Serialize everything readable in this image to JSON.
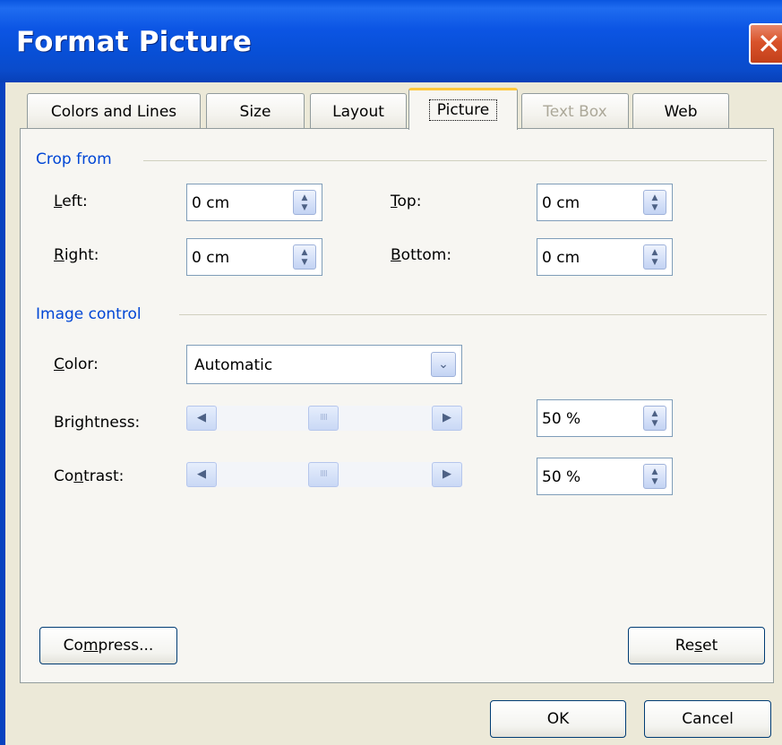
{
  "window": {
    "title": "Format Picture",
    "close_glyph": "✕"
  },
  "tabs": [
    {
      "label": "Colors and Lines",
      "state": "normal"
    },
    {
      "label": "Size",
      "state": "normal"
    },
    {
      "label": "Layout",
      "state": "normal"
    },
    {
      "label": "Picture",
      "state": "active"
    },
    {
      "label": "Text Box",
      "state": "disabled"
    },
    {
      "label": "Web",
      "state": "normal"
    }
  ],
  "crop": {
    "group_label": "Crop from",
    "left": {
      "label_pre": "",
      "label_u": "L",
      "label_post": "eft:",
      "value": "0 cm"
    },
    "top": {
      "label_pre": "",
      "label_u": "T",
      "label_post": "op:",
      "value": "0 cm"
    },
    "right": {
      "label_pre": "",
      "label_u": "R",
      "label_post": "ight:",
      "value": "0 cm"
    },
    "bottom": {
      "label_pre": "",
      "label_u": "B",
      "label_post": "ottom:",
      "value": "0 cm"
    }
  },
  "image_control": {
    "group_label": "Image control",
    "color": {
      "label_pre": "",
      "label_u": "C",
      "label_post": "olor:",
      "value": "Automatic"
    },
    "brightness": {
      "label_pre": "Bri",
      "label_u": "g",
      "label_post": "htness:",
      "value": "50 %",
      "level": 0.5
    },
    "contrast": {
      "label_pre": "Co",
      "label_u": "n",
      "label_post": "trast:",
      "value": "50 %",
      "level": 0.5
    }
  },
  "buttons": {
    "compress": {
      "pre": "Co",
      "u": "m",
      "post": "press..."
    },
    "reset": {
      "pre": "Re",
      "u": "s",
      "post": "et"
    },
    "ok": "OK",
    "cancel": "Cancel"
  },
  "icons": {
    "spin_up": "▲",
    "spin_down": "▼",
    "dropdown": "⌄",
    "scroll_left": "◀",
    "scroll_right": "▶",
    "thumb_grip": "IIII"
  }
}
